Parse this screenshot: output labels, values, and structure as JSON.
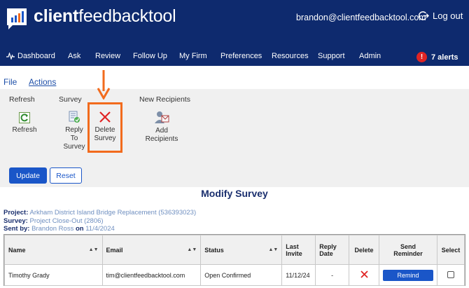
{
  "header": {
    "brand_bold": "client",
    "brand_light": "feedbacktool",
    "user_email": "brandon@clientfeedbacktool.com",
    "logout_label": "Log out",
    "nav": [
      "Dashboard",
      "Ask",
      "Review",
      "Follow Up",
      "My Firm",
      "Preferences",
      "Resources",
      "Support",
      "Admin"
    ],
    "alerts_count": "!",
    "alerts_label": "7 alerts"
  },
  "menu_tabs": [
    "File",
    "Actions"
  ],
  "ribbon": {
    "groups": [
      "Refresh",
      "Survey",
      "New Recipients"
    ],
    "tools": {
      "refresh": "Refresh",
      "reply_line1": "Reply",
      "reply_line2": "To",
      "reply_line3": "Survey",
      "delete_line1": "Delete",
      "delete_line2": "Survey",
      "add_line1": "Add",
      "add_line2": "Recipients"
    },
    "update_label": "Update",
    "reset_label": "Reset"
  },
  "page_title": "Modify Survey",
  "meta": {
    "project_label": "Project:",
    "project_value": "Arkham District Island Bridge Replacement (536393023)",
    "survey_label": "Survey:",
    "survey_value": "Project Close-Out (2806)",
    "sent_label": "Sent by:",
    "sent_value": "Brandon Ross",
    "on_label": "on",
    "sent_date": "11/4/2024"
  },
  "table": {
    "headers": {
      "name": "Name",
      "email": "Email",
      "status": "Status",
      "last_invite_1": "Last",
      "last_invite_2": "Invite",
      "reply_date_1": "Reply",
      "reply_date_2": "Date",
      "delete": "Delete",
      "send_1": "Send",
      "send_2": "Reminder",
      "select": "Select"
    },
    "rows": [
      {
        "name": "Timothy Grady",
        "email": "tim@clientfeedbacktool.com",
        "status": "Open Confirmed",
        "last_invite": "11/12/24",
        "reply_date": "-",
        "remind_label": "Remind"
      }
    ]
  },
  "colors": {
    "header_bg": "#0e2a6e",
    "accent_blue": "#1a56c8",
    "highlight_orange": "#f26b1d",
    "delete_red": "#e02424"
  }
}
